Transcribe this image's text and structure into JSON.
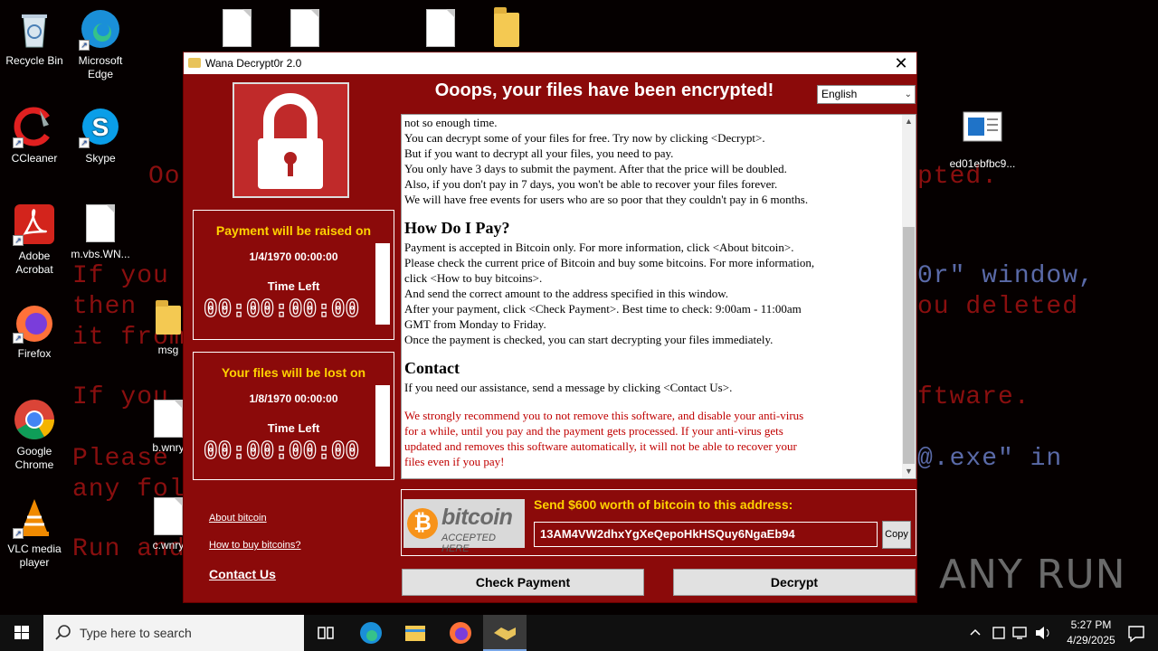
{
  "desktop": {
    "background_lines": [
      "Oo",
      "pted.",
      "If you",
      "0r\" window,",
      "then",
      "ou deleted",
      "it from",
      "If you",
      "ftware.",
      "Please",
      "@.exe\" in",
      "any fol",
      "Run and"
    ],
    "icons": {
      "recycle_bin": "Recycle Bin",
      "edge": "Microsoft Edge",
      "ccleaner": "CCleaner",
      "skype": "Skype",
      "acrobat": "Adobe Acrobat",
      "mvbs": "m.vbs.WN...",
      "firefox": "Firefox",
      "msg": "msg",
      "chrome": "Google Chrome",
      "bwnry": "b.wnry",
      "vlc": "VLC media player",
      "cwnry": "c.wnry",
      "ed01": "ed01ebfbc9..."
    }
  },
  "window": {
    "title": "Wana Decrypt0r 2.0",
    "headline": "Ooops, your files have been encrypted!",
    "language": "English",
    "raise": {
      "title": "Payment will be raised on",
      "date": "1/4/1970 00:00:00",
      "time_left_label": "Time Left",
      "counter": "00:00:00:00",
      "fill": 1.0
    },
    "lost": {
      "title": "Your files will be lost on",
      "date": "1/8/1970 00:00:00",
      "time_left_label": "Time Left",
      "counter": "00:00:00:00",
      "fill": 1.0
    },
    "links": {
      "about_bitcoin": "About bitcoin",
      "how_to_buy": "How to buy bitcoins?",
      "contact_us": "Contact Us"
    },
    "text": {
      "p1": [
        "not so enough time.",
        "You can decrypt some of your files for free. Try now by clicking <Decrypt>.",
        "But if you want to decrypt all your files, you need to pay.",
        "You only have 3 days to submit the payment. After that the price will be doubled.",
        "Also, if you don't pay in 7 days, you won't be able to recover your files forever.",
        "We will have free events for users who are so poor that they couldn't pay in 6 months."
      ],
      "h_pay": "How Do I Pay?",
      "p2": [
        "Payment is accepted in Bitcoin only. For more information, click <About bitcoin>.",
        "Please check the current price of Bitcoin and buy some bitcoins. For more information,",
        "click <How to buy bitcoins>.",
        "And send the correct amount to the address specified in this window.",
        "After your payment, click <Check Payment>. Best time to check: 9:00am - 11:00am",
        "GMT from Monday to Friday.",
        "Once the payment is checked, you can start decrypting your files immediately."
      ],
      "h_contact": "Contact",
      "p3": "If you need our assistance, send a message by clicking <Contact Us>.",
      "warning": [
        "We strongly recommend you to not remove this software, and disable your anti-virus",
        "for a while, until you pay and the payment gets processed. If your anti-virus gets",
        "updated and removes this software automatically, it will not be able to recover your",
        "files even if you pay!"
      ]
    },
    "bitcoin": {
      "logo_word": "bitcoin",
      "logo_sub": "ACCEPTED HERE",
      "send_title": "Send $600 worth of bitcoin to this address:",
      "address": "13AM4VW2dhxYgXeQepoHkHSQuy6NgaEb94",
      "copy_label": "Copy"
    },
    "buttons": {
      "check_payment": "Check Payment",
      "decrypt": "Decrypt"
    }
  },
  "taskbar": {
    "search_placeholder": "Type here to search",
    "time": "5:27 PM",
    "date": "4/29/2025"
  },
  "watermark": "ANY RUN",
  "colors": {
    "window_bg": "#8b0a0a",
    "accent_yellow": "#ffd200",
    "warning_red": "#c00000"
  }
}
